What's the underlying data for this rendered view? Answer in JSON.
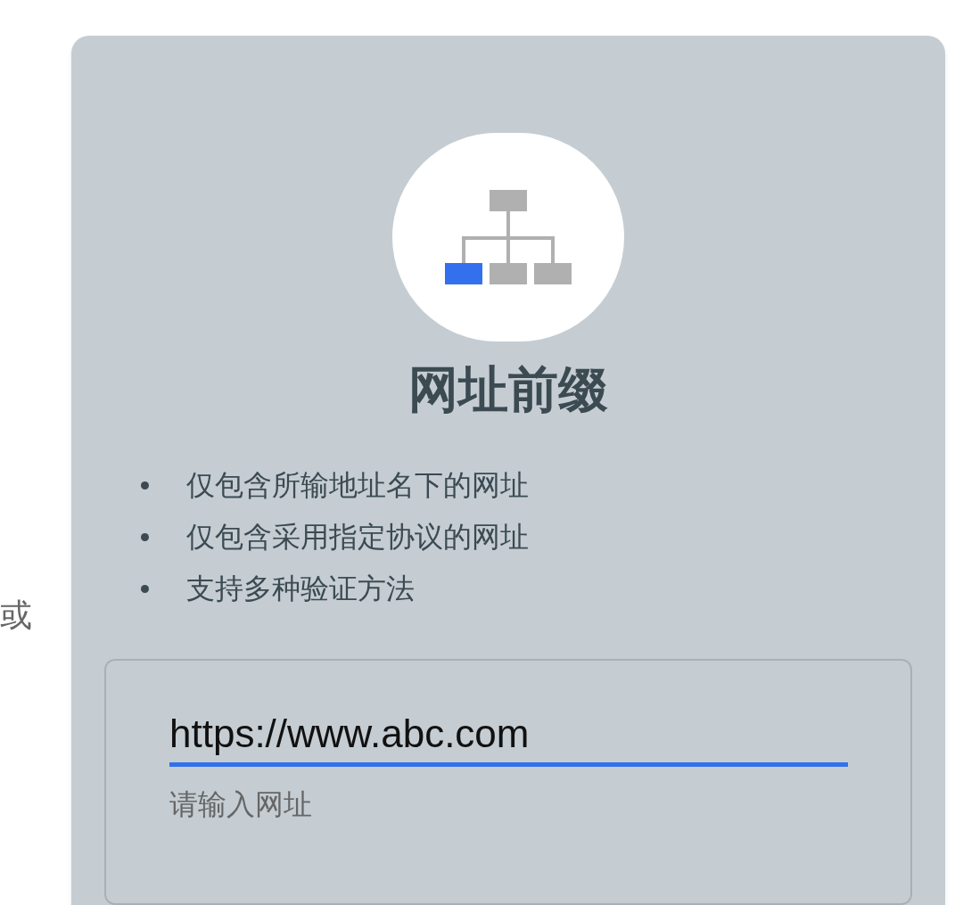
{
  "separator_text": "或",
  "card": {
    "title": "网址前缀",
    "bullets": [
      "仅包含所输地址名下的网址",
      "仅包含采用指定协议的网址",
      "支持多种验证方法"
    ],
    "url_field": {
      "value": "https://www.abc.com",
      "helper": "请输入网址"
    }
  }
}
